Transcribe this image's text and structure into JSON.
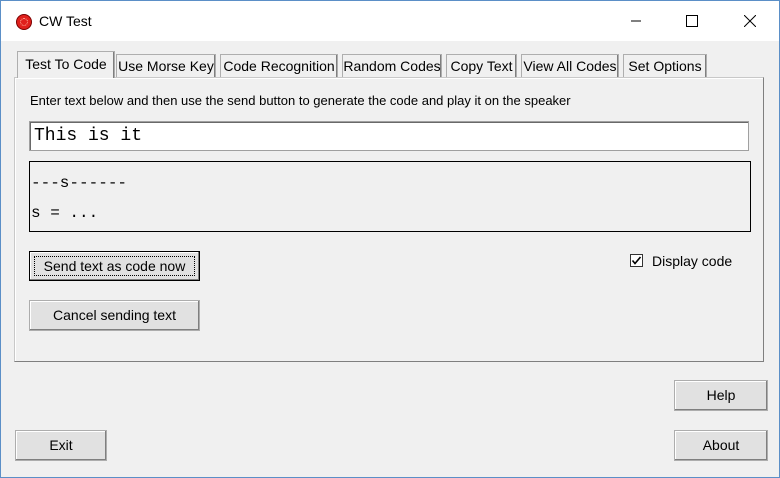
{
  "window": {
    "title": "CW Test",
    "icon": "red-record-icon"
  },
  "tabs": [
    {
      "label": "Test To Code",
      "active": true
    },
    {
      "label": "Use Morse Key",
      "active": false
    },
    {
      "label": "Code Recognition",
      "active": false
    },
    {
      "label": "Random Codes",
      "active": false
    },
    {
      "label": "Copy Text",
      "active": false
    },
    {
      "label": "View All Codes",
      "active": false
    },
    {
      "label": "Set Options",
      "active": false
    }
  ],
  "main": {
    "instruction": "Enter text below and then use the send button to generate the code and play it on the  speaker",
    "input_value": "This is it",
    "code_line1": "---s------",
    "code_line2": "s = ...",
    "send_label": "Send text as code now",
    "cancel_label": "Cancel sending text",
    "display_code_label": "Display code",
    "display_code_checked": true
  },
  "footer": {
    "help_label": "Help",
    "exit_label": "Exit",
    "about_label": "About"
  }
}
